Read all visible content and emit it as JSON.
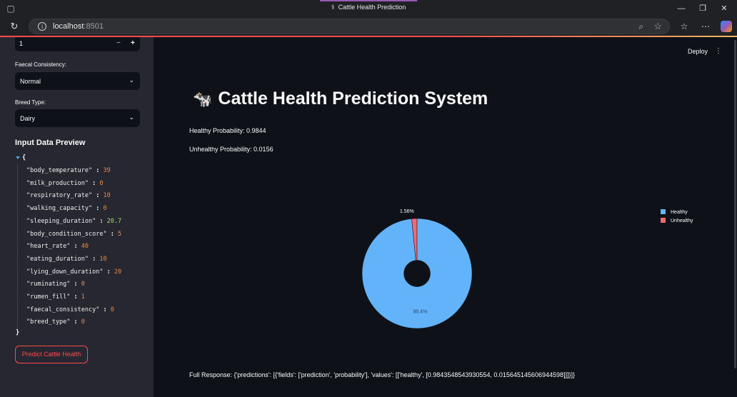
{
  "browser": {
    "tab_title": "Cattle Health Prediction",
    "url_host": "localhost",
    "url_port": ":8501",
    "accent": "#ff4b4b"
  },
  "sidebar": {
    "number_input_value": "1",
    "faecal_label": "Faecal Consistency:",
    "faecal_value": "Normal",
    "breed_label": "Breed Type:",
    "breed_value": "Dairy",
    "preview_heading": "Input Data Preview",
    "json_rows": [
      {
        "key": "\"body_temperature\"",
        "value": "39",
        "kind": "num"
      },
      {
        "key": "\"milk_production\"",
        "value": "0",
        "kind": "num"
      },
      {
        "key": "\"respiratory_rate\"",
        "value": "10",
        "kind": "num"
      },
      {
        "key": "\"walking_capacity\"",
        "value": "0",
        "kind": "num"
      },
      {
        "key": "\"sleeping_duration\"",
        "value": "20.7",
        "kind": "flt"
      },
      {
        "key": "\"body_condition_score\"",
        "value": "5",
        "kind": "num"
      },
      {
        "key": "\"heart_rate\"",
        "value": "40",
        "kind": "num"
      },
      {
        "key": "\"eating_duration\"",
        "value": "10",
        "kind": "num"
      },
      {
        "key": "\"lying_down_duration\"",
        "value": "20",
        "kind": "num"
      },
      {
        "key": "\"ruminating\"",
        "value": "0",
        "kind": "num"
      },
      {
        "key": "\"rumen_fill\"",
        "value": "1",
        "kind": "num"
      },
      {
        "key": "\"faecal_consistency\"",
        "value": "0",
        "kind": "num"
      },
      {
        "key": "\"breed_type\"",
        "value": "0",
        "kind": "num"
      }
    ],
    "predict_label": "Predict Cattle Health"
  },
  "header": {
    "deploy_label": "Deploy"
  },
  "main": {
    "title": "Cattle Health Prediction System",
    "healthy_text": "Healthy Probability: 0.9844",
    "unhealthy_text": "Unhealthy Probability: 0.0156",
    "full_response": "Full Response: {'predictions': [{'fields': ['prediction', 'probability'], 'values': [['healthy', [0.9843548543930554, 0.015645145606944598]]]}]}"
  },
  "chart_data": {
    "type": "pie",
    "hole": 0.3,
    "categories": [
      "Healthy",
      "Unhealthy"
    ],
    "values": [
      0.9843548543930554,
      0.015645145606944598
    ],
    "labels": [
      "98.4%",
      "1.56%"
    ],
    "colors": [
      "#63b3fb",
      "#ef6b73"
    ],
    "legend_position": "top-right"
  }
}
